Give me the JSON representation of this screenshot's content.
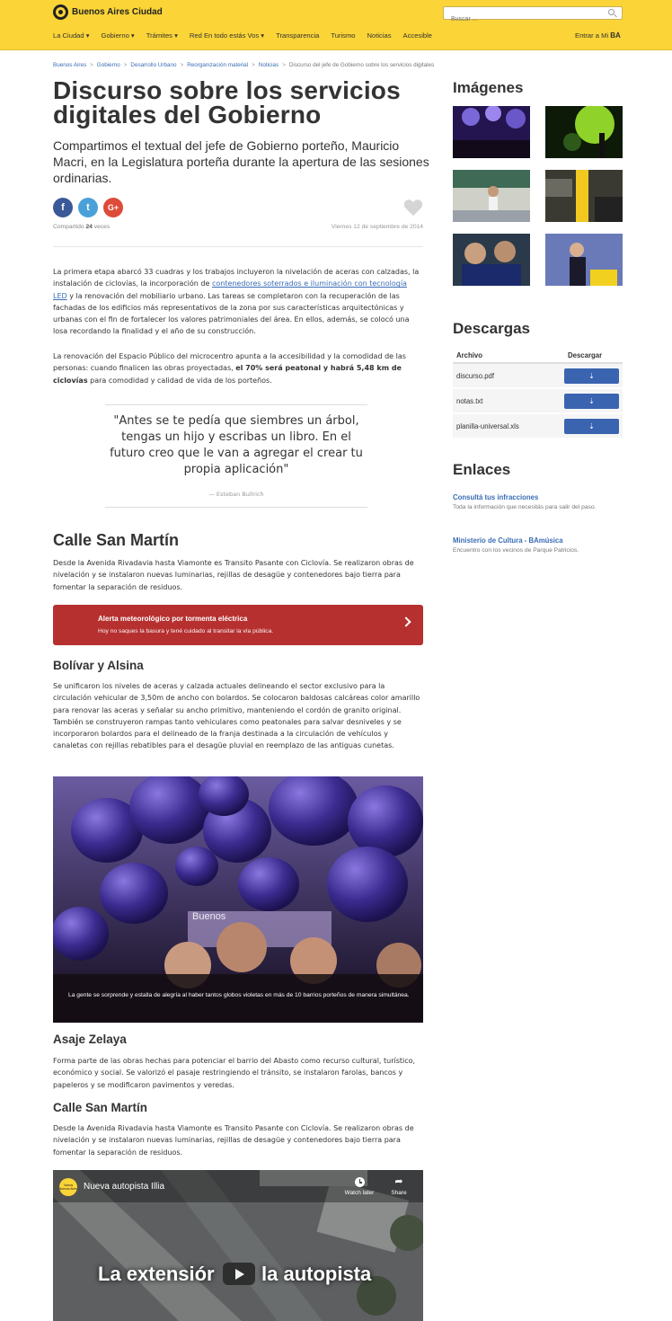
{
  "header": {
    "logo_text": "Buenos Aires Ciudad",
    "search_placeholder": "Buscar ...",
    "nav": [
      "La Ciudad ▾",
      "Gobierno ▾",
      "Trámites ▾",
      "Red En todo estás Vos ▾",
      "Transparencia",
      "Turismo",
      "Noticias",
      "Accesible"
    ],
    "login_text": "Entrar a Mi",
    "login_brand": "BA"
  },
  "breadcrumb": [
    "Buenos Aires",
    "Gobierno",
    "Desarrollo Urbano",
    "Reorganización material",
    "Noticias",
    "Discurso del jefe de Gobierno sobre los servicios digitales"
  ],
  "article": {
    "title": "Discurso sobre los servicios digitales del Gobierno",
    "lead": "Compartimos el textual del jefe de Gobierno porteño, Mauricio Macri, en la Legislatura porteña durante la apertura de las sesiones ordinarias.",
    "share": {
      "fb": "f",
      "tw": "t",
      "gp": "G+"
    },
    "shared_prefix": "Compartido",
    "shared_count": "24",
    "shared_suffix": "veces",
    "date": "Viernes 12 de septiembre de 2014",
    "p1_a": "La primera etapa abarcó 33 cuadras y los trabajos incluyeron la nivelación de aceras con calzadas, la instalación de ciclovías, la incorporación de ",
    "p1_link": "contenedores soterrados e iluminación con tecnología LED",
    "p1_b": " y la renovación del mobiliario urbano. Las tareas se completaron con la recuperación de las fachadas de los edificios más representativos de la zona por sus características arquitectónicas y urbanas con el fin de fortalecer los valores patrimoniales del área. En ellos, además, se colocó una losa recordando la finalidad y el año de su construcción.",
    "p2_a": "La renovación del Espacio Público del microcentro apunta a la accesibilidad y la comodidad de las personas: cuando finalicen las obras proyectadas, ",
    "p2_bold": "el 70% será peatonal y habrá 5,48 km de ciclovías",
    "p2_b": " para comodidad y calidad de vida de los porteños.",
    "quote": "\"Antes se te pedía que siembres un árbol, tengas un hijo y escribas un libro. En el futuro creo que le van a agregar el crear tu propia aplicación\"",
    "quote_author": "— Esteban Bullrich",
    "h_sanmartin": "Calle San Martín",
    "p_sanmartin": "Desde la Avenida Rivadavia hasta Viamonte es Transito Pasante con Ciclovía. Se realizaron obras de nivelación y se instalaron nuevas luminarias, rejillas de desagüe y contenedores bajo tierra para fomentar la separación de residuos.",
    "alert_title": "Alerta meteorológico por tormenta eléctrica",
    "alert_text": "Hoy no saques la basura y tené cuidado al transitar la vía pública.",
    "h_bolivar": "Bolívar y Alsina",
    "p_bolivar": "Se unificaron los niveles de aceras y calzada actuales delineando el sector exclusivo para la circulación vehicular de 3,50m de ancho con bolardos. Se colocaron baldosas calcáreas color amarillo para renovar las aceras y señalar su ancho primitivo, manteniendo el cordón de granito original. También se construyeron rampas tanto vehiculares como peatonales para salvar desniveles y se incorporaron bolardos para el delineado de la franja destinada a la circulación de vehículos y canaletas con rejillas rebatibles para el desagüe pluvial en reemplazo de las antiguas cunetas.",
    "photo_caption": "La gente se sorprende y estalla de alegría al haber tantos globos violetas en más de 10 barrios porteños de manera simultánea.",
    "photo_sign": "Buenos",
    "h_zelaya": "Asaje Zelaya",
    "p_zelaya": "Forma parte de las obras hechas para potenciar el barrio del Abasto como recurso cultural, turístico, económico y social. Se valorizó el pasaje restringiendo el tránsito, se instalaron farolas, bancos y papeleros y se modificaron pavimentos y veredas.",
    "h_sanmartin2": "Calle San Martín",
    "p_sanmartin2": "Desde la Avenida Rivadavia hasta Viamonte es Transito Pasante con Ciclovía. Se realizaron obras de nivelación y se instalaron nuevas luminarias, rejillas de desagüe y contenedores bajo tierra para fomentar la separación de residuos.",
    "video": {
      "channel_badge": "Vamos Buenos Aires",
      "title": "Nueva autopista Illia",
      "watch_later": "Watch later",
      "share": "Share",
      "overlay_left": "La extensiór",
      "overlay_right": "la autopista"
    }
  },
  "aside": {
    "images_title": "Imágenes",
    "downloads_title": "Descargas",
    "downloads_headers": [
      "Archivo",
      "Descargar"
    ],
    "downloads": [
      "discurso.pdf",
      "notas.txt",
      "planilla-universal.xls"
    ],
    "download_icon": "⇣",
    "links_title": "Enlaces",
    "links": [
      {
        "title": "Consultá tus infracciones",
        "desc": "Toda la información que necesitás para salir del paso."
      },
      {
        "title": "Ministerio de Cultura - BAmúsica",
        "desc": "Encuentro con los vecinos de Parque Patricios."
      }
    ]
  }
}
